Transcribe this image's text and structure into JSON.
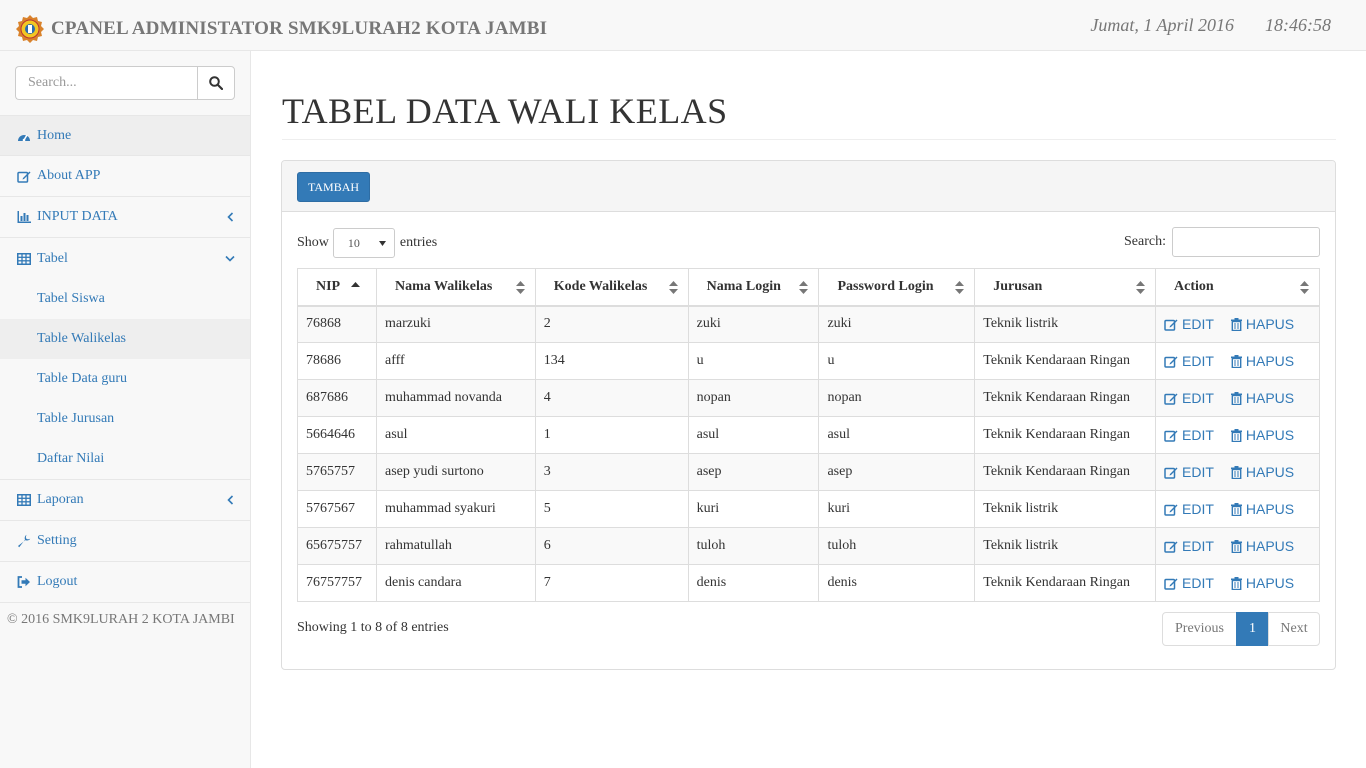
{
  "header": {
    "brand": "CPANEL ADMINISTATOR SMK9LURAH2 KOTA JAMBI",
    "date": "Jumat, 1 April 2016",
    "time": "18:46:58"
  },
  "sidebar": {
    "search_placeholder": "Search...",
    "items": [
      {
        "label": "Home",
        "icon": "dashboard-icon"
      },
      {
        "label": "About APP",
        "icon": "edit-icon"
      },
      {
        "label": "INPUT DATA",
        "icon": "bar-chart-icon"
      },
      {
        "label": "Tabel",
        "icon": "table-icon"
      },
      {
        "label": "Laporan",
        "icon": "table-icon"
      },
      {
        "label": "Setting",
        "icon": "wrench-icon"
      },
      {
        "label": "Logout",
        "icon": "logout-icon"
      }
    ],
    "sub_items": [
      {
        "label": "Tabel Siswa"
      },
      {
        "label": "Table Walikelas"
      },
      {
        "label": "Table Data guru"
      },
      {
        "label": "Table Jurusan"
      },
      {
        "label": "Daftar Nilai"
      }
    ],
    "copyright": "© 2016 SMK9LURAH 2 KOTA JAMBI"
  },
  "main": {
    "title": "TABEL DATA WALI KELAS",
    "add_button": "TAMBAH",
    "show_label": "Show",
    "entries_label": "entries",
    "page_size": "10",
    "search_label": "Search:",
    "columns": [
      "NIP",
      "Nama Walikelas",
      "Kode Walikelas",
      "Nama Login",
      "Password Login",
      "Jurusan",
      "Action"
    ],
    "edit_label": "EDIT",
    "delete_label": "HAPUS",
    "rows": [
      {
        "nip": "76868",
        "nama": "marzuki",
        "kode": "2",
        "login": "zuki",
        "password": "zuki",
        "jurusan": "Teknik listrik"
      },
      {
        "nip": "78686",
        "nama": "afff",
        "kode": "134",
        "login": "u",
        "password": "u",
        "jurusan": "Teknik Kendaraan Ringan"
      },
      {
        "nip": "687686",
        "nama": "muhammad novanda",
        "kode": "4",
        "login": "nopan",
        "password": "nopan",
        "jurusan": "Teknik Kendaraan Ringan"
      },
      {
        "nip": "5664646",
        "nama": "asul",
        "kode": "1",
        "login": "asul",
        "password": "asul",
        "jurusan": "Teknik Kendaraan Ringan"
      },
      {
        "nip": "5765757",
        "nama": "asep yudi surtono",
        "kode": "3",
        "login": "asep",
        "password": "asep",
        "jurusan": "Teknik Kendaraan Ringan"
      },
      {
        "nip": "5767567",
        "nama": "muhammad syakuri",
        "kode": "5",
        "login": "kuri",
        "password": "kuri",
        "jurusan": "Teknik listrik"
      },
      {
        "nip": "65675757",
        "nama": "rahmatullah",
        "kode": "6",
        "login": "tuloh",
        "password": "tuloh",
        "jurusan": "Teknik listrik"
      },
      {
        "nip": "76757757",
        "nama": "denis candara",
        "kode": "7",
        "login": "denis",
        "password": "denis",
        "jurusan": "Teknik Kendaraan Ringan"
      }
    ],
    "info": "Showing 1 to 8 of 8 entries",
    "pagination": {
      "previous": "Previous",
      "current": "1",
      "next": "Next"
    }
  },
  "colors": {
    "link": "#337ab7",
    "muted": "#777777",
    "border": "#dddddd"
  }
}
